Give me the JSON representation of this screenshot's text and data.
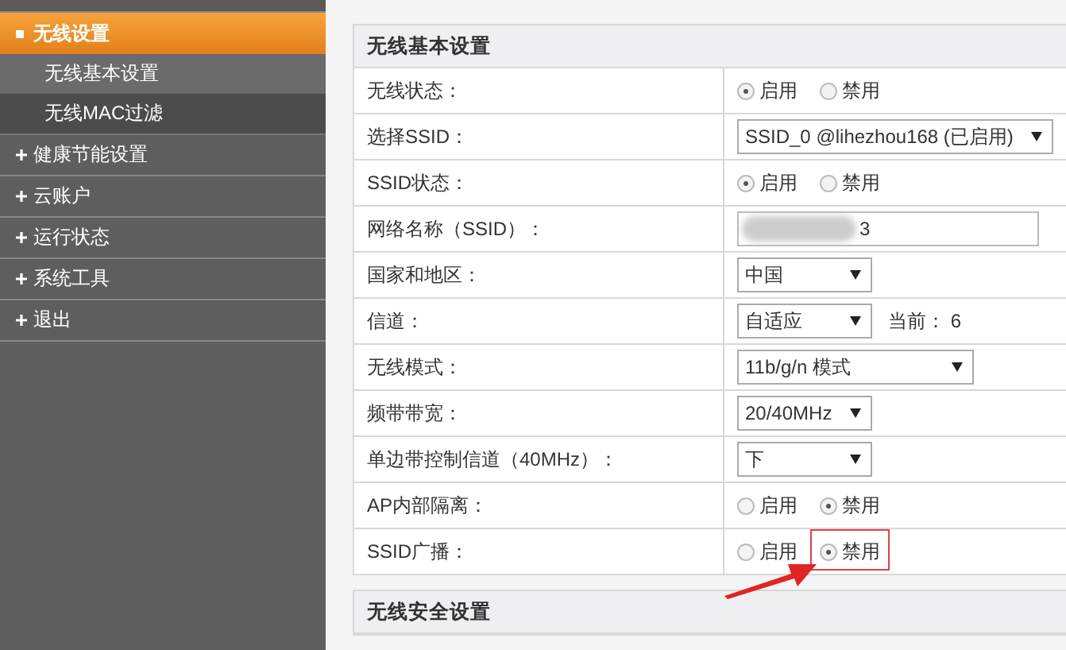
{
  "sidebar": {
    "items": [
      {
        "kind": "cut"
      },
      {
        "label": "无线设置",
        "kind": "group",
        "selected": true,
        "children": [
          {
            "label": "无线基本设置",
            "selected": true
          },
          {
            "label": "无线MAC过滤",
            "selected": false
          }
        ]
      },
      {
        "label": "健康节能设置",
        "kind": "group",
        "selected": false
      },
      {
        "label": "云账户",
        "kind": "group",
        "selected": false
      },
      {
        "label": "运行状态",
        "kind": "group",
        "selected": false
      },
      {
        "label": "系统工具",
        "kind": "group",
        "selected": false
      },
      {
        "label": "退出",
        "kind": "group",
        "selected": false
      }
    ]
  },
  "sections": [
    {
      "title": "无线基本设置",
      "rows": [
        {
          "label": "无线状态：",
          "kind": "radio",
          "options": [
            {
              "label": "启用",
              "selected": true
            },
            {
              "label": "禁用",
              "selected": false
            }
          ]
        },
        {
          "label": "选择SSID：",
          "kind": "select",
          "value": "SSID_0 @lihezhou168 (已启用)"
        },
        {
          "label": "SSID状态：",
          "kind": "radio",
          "options": [
            {
              "label": "启用",
              "selected": true
            },
            {
              "label": "禁用",
              "selected": false
            }
          ]
        },
        {
          "label": "网络名称（SSID）：",
          "kind": "text",
          "value": "3",
          "redacted": true
        },
        {
          "label": "国家和地区：",
          "kind": "select",
          "value": "中国"
        },
        {
          "label": "信道：",
          "kind": "select",
          "value": "自适应",
          "note": "当前：  6"
        },
        {
          "label": "无线模式：",
          "kind": "select",
          "value": "11b/g/n 模式"
        },
        {
          "label": "频带带宽：",
          "kind": "select",
          "value": "20/40MHz"
        },
        {
          "label": "单边带控制信道（40MHz）：",
          "kind": "select",
          "value": "下"
        },
        {
          "label": "AP内部隔离：",
          "kind": "radio",
          "options": [
            {
              "label": "启用",
              "selected": false
            },
            {
              "label": "禁用",
              "selected": true
            }
          ]
        },
        {
          "label": "SSID广播：",
          "kind": "radio",
          "options": [
            {
              "label": "启用",
              "selected": false
            },
            {
              "label": "禁用",
              "selected": true,
              "highlighted": true
            }
          ]
        }
      ]
    },
    {
      "title": "无线安全设置"
    }
  ]
}
